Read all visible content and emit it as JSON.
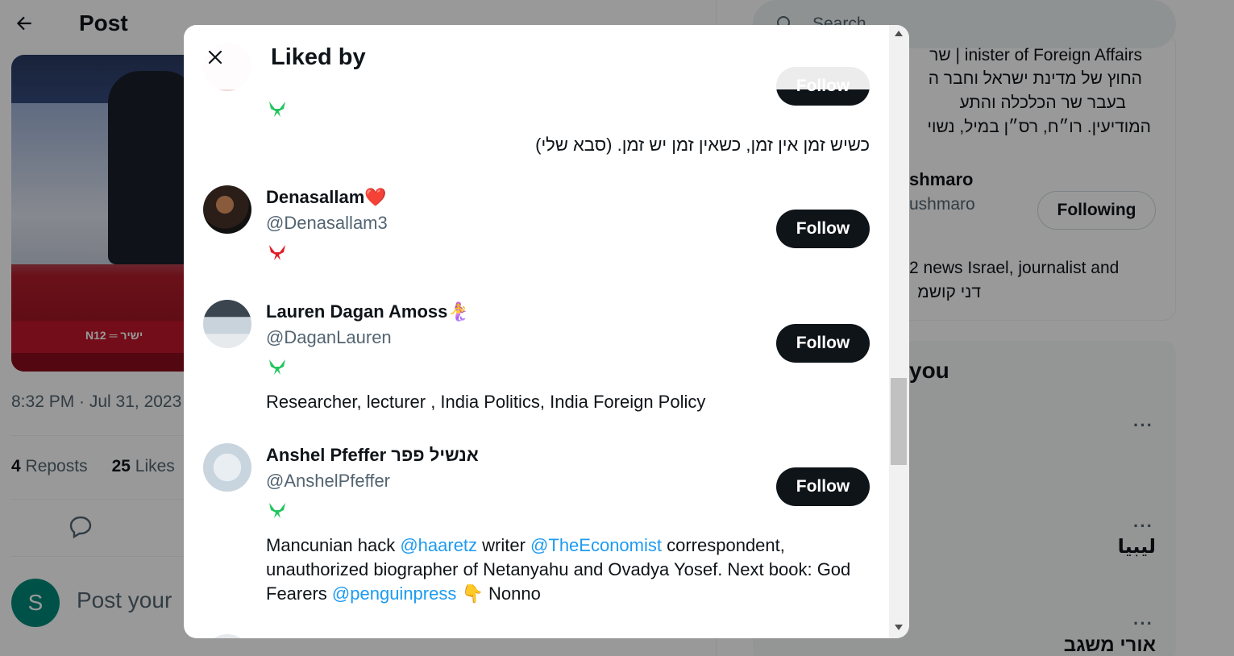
{
  "background": {
    "page_title": "Post",
    "post_time": "8:32 PM · Jul 31, 2023",
    "stats": {
      "reposts_count": "4",
      "reposts_label": "Reposts",
      "likes_count": "25",
      "likes_label": "Likes"
    },
    "composer": {
      "avatar_letter": "S",
      "placeholder": "Post your"
    },
    "media_strip": "N12 ═ ישיר",
    "search_placeholder": "Search",
    "profile_card": {
      "line1": "inister of Foreign Affairs | שר",
      "line2": "החוץ של מדינת ישראל וחבר ה",
      "line3": "בעבר שר הכלכלה והתע",
      "line4": "המודיעין. רו״ח, רס״ן במיל, נשוי",
      "name": "shmaro",
      "handle": "ushmaro",
      "following_label": "Following",
      "bio_line1": "2 news Israel, journalist and",
      "bio_line2": "דני קושמ"
    },
    "who_to_follow": {
      "title": "you",
      "name1": "ليبيا",
      "name2": "אורי משגב",
      "more": "···"
    }
  },
  "modal": {
    "title": "Liked by",
    "follow_label": "Follow",
    "users": [
      {
        "bio": "כשיש זמן אין זמן, כשאין זמן יש זמן. (סבא שלי)",
        "badge_color": "#22c55e"
      },
      {
        "name": "Denasallam❤️",
        "handle": "@Denasallam3",
        "badge_color": "#e11d2a"
      },
      {
        "name": "Lauren Dagan Amoss🧜‍♀️",
        "handle": "@DaganLauren",
        "bio": "Researcher, lecturer , India Politics, India Foreign Policy",
        "badge_color": "#22c55e"
      },
      {
        "name": "Anshel Pfeffer אנשיל פפר",
        "handle": "@AnshelPfeffer",
        "badge_color": "#22c55e",
        "bio_parts": {
          "t1": "Mancunian hack ",
          "m1": "@haaretz",
          "t2": " writer ",
          "m2": "@TheEconomist",
          "t3": " correspondent, unauthorized biographer of Netanyahu and Ovadya Yosef. Next book: God Fearers ",
          "m3": "@penguinpress",
          "t4": " 👇 Nonno"
        }
      }
    ]
  },
  "colors": {
    "accent": "#1d9bf0",
    "button_dark": "#0f1419",
    "secondary_text": "#536471"
  }
}
